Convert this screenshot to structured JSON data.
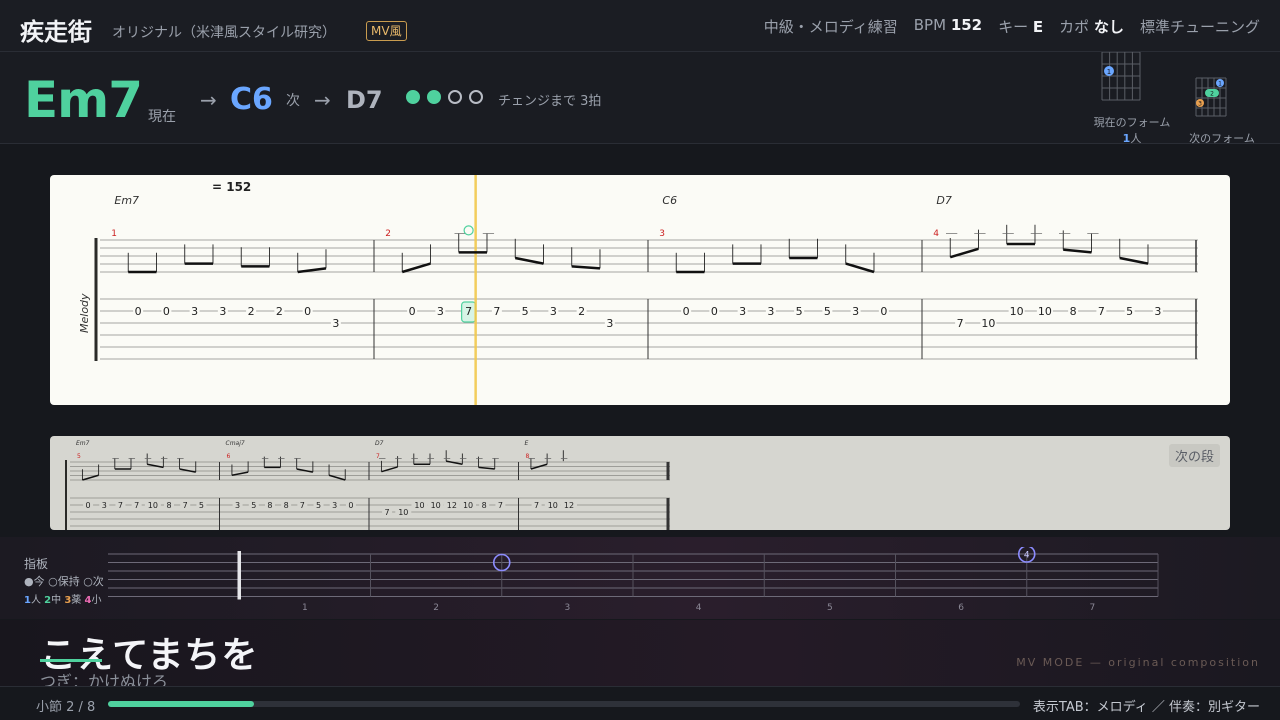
{
  "header": {
    "title": "疾走街",
    "subtitle": "オリジナル（米津風スタイル研究）",
    "badge": "MV風",
    "level": "中級・メロディ練習",
    "bpm_label": "BPM",
    "bpm_value": "152",
    "key_label": "キー",
    "key_value": "E",
    "capo_label": "カポ",
    "capo_value": "なし",
    "tuning": "標準チューニング"
  },
  "chords": {
    "current": "Em7",
    "current_label": "現在",
    "arrow": "→",
    "next": "C6",
    "next_label": "次",
    "after": "D7",
    "beats_total": 4,
    "beats_done": 2,
    "change_text": "チェンジまで 3拍",
    "current_form_label": "現在のフォーム",
    "current_form_finger": "1",
    "current_form_finger_suffix": "人",
    "next_form_label": "次のフォーム",
    "current_form_dots": [
      {
        "label": "1",
        "color": "#6aa6ff"
      }
    ],
    "next_form_dots": [
      {
        "label": "1",
        "color": "#6aa6ff"
      },
      {
        "label": "2",
        "color": "#4fd19e"
      },
      {
        "label": "3",
        "color": "#e9a04f"
      }
    ]
  },
  "tab": {
    "tempo": "= 152",
    "track_name": "Melody",
    "measures": [
      {
        "number": "1",
        "chord": "Em7",
        "notes": [
          {
            "fret": "0",
            "string": 2
          },
          {
            "fret": "0",
            "string": 2
          },
          {
            "fret": "3",
            "string": 2
          },
          {
            "fret": "3",
            "string": 2
          },
          {
            "fret": "2",
            "string": 2
          },
          {
            "fret": "2",
            "string": 2
          },
          {
            "fret": "0",
            "string": 2
          },
          {
            "fret": "3",
            "string": 3
          }
        ]
      },
      {
        "number": "2",
        "chord": "",
        "notes": [
          {
            "fret": "0",
            "string": 2
          },
          {
            "fret": "3",
            "string": 2
          },
          {
            "fret": "7",
            "string": 2,
            "current": true
          },
          {
            "fret": "7",
            "string": 2
          },
          {
            "fret": "5",
            "string": 2
          },
          {
            "fret": "3",
            "string": 2
          },
          {
            "fret": "2",
            "string": 2
          },
          {
            "fret": "3",
            "string": 3
          }
        ]
      },
      {
        "number": "3",
        "chord": "C6",
        "notes": [
          {
            "fret": "0",
            "string": 2
          },
          {
            "fret": "0",
            "string": 2
          },
          {
            "fret": "3",
            "string": 2
          },
          {
            "fret": "3",
            "string": 2
          },
          {
            "fret": "5",
            "string": 2
          },
          {
            "fret": "5",
            "string": 2
          },
          {
            "fret": "3",
            "string": 2
          },
          {
            "fret": "0",
            "string": 2
          }
        ]
      },
      {
        "number": "4",
        "chord": "D7",
        "notes": [
          {
            "fret": "7",
            "string": 3
          },
          {
            "fret": "10",
            "string": 3
          },
          {
            "fret": "10",
            "string": 2
          },
          {
            "fret": "10",
            "string": 2
          },
          {
            "fret": "8",
            "string": 2
          },
          {
            "fret": "7",
            "string": 2
          },
          {
            "fret": "5",
            "string": 2
          },
          {
            "fret": "3",
            "string": 2
          }
        ]
      }
    ],
    "next_stage_label": "次の段",
    "next_measures": [
      {
        "number": "5",
        "chord": "Em7",
        "notes": [
          {
            "fret": "0",
            "string": 2
          },
          {
            "fret": "3",
            "string": 2
          },
          {
            "fret": "7",
            "string": 2
          },
          {
            "fret": "7",
            "string": 2
          },
          {
            "fret": "10",
            "string": 2
          },
          {
            "fret": "8",
            "string": 2
          },
          {
            "fret": "7",
            "string": 2
          },
          {
            "fret": "5",
            "string": 2
          }
        ]
      },
      {
        "number": "6",
        "chord": "Cmaj7",
        "notes": [
          {
            "fret": "3",
            "string": 2
          },
          {
            "fret": "5",
            "string": 2
          },
          {
            "fret": "8",
            "string": 2
          },
          {
            "fret": "8",
            "string": 2
          },
          {
            "fret": "7",
            "string": 2
          },
          {
            "fret": "5",
            "string": 2
          },
          {
            "fret": "3",
            "string": 2
          },
          {
            "fret": "0",
            "string": 2
          }
        ]
      },
      {
        "number": "7",
        "chord": "D7",
        "notes": [
          {
            "fret": "7",
            "string": 3
          },
          {
            "fret": "10",
            "string": 3
          },
          {
            "fret": "10",
            "string": 2
          },
          {
            "fret": "10",
            "string": 2
          },
          {
            "fret": "12",
            "string": 2
          },
          {
            "fret": "10",
            "string": 2
          },
          {
            "fret": "8",
            "string": 2
          },
          {
            "fret": "7",
            "string": 2
          }
        ]
      },
      {
        "number": "8",
        "chord": "E",
        "notes": [
          {
            "fret": "7",
            "string": 2
          },
          {
            "fret": "10",
            "string": 2
          },
          {
            "fret": "12",
            "string": 2
          }
        ]
      }
    ]
  },
  "fretboard": {
    "title": "指板",
    "legend": "●今 ○保持 ○次",
    "fingers": [
      {
        "num": "1",
        "name": "人"
      },
      {
        "num": "2",
        "name": "中"
      },
      {
        "num": "3",
        "name": "薬"
      },
      {
        "num": "4",
        "name": "小"
      }
    ],
    "fret_numbers": [
      "1",
      "2",
      "3",
      "4",
      "5",
      "6",
      "7"
    ],
    "markers": [
      {
        "fret": 3,
        "string": 2,
        "label": ""
      },
      {
        "fret": 7,
        "string": 1,
        "label": "4"
      }
    ]
  },
  "lyrics": {
    "current": "こえてまちを",
    "next": "つぎ：かけぬけろ",
    "mode": "MV MODE — original composition"
  },
  "footer": {
    "measure": "小節 2 / 8",
    "progress": 0.16,
    "tab_info": "表示TAB：メロディ ／ 伴奏：別ギター"
  },
  "colors": {
    "accent": "#4fd19e",
    "next_chord": "#6aa6ff",
    "playhead": "#f2c94c",
    "measure_number": "#cc2222"
  }
}
